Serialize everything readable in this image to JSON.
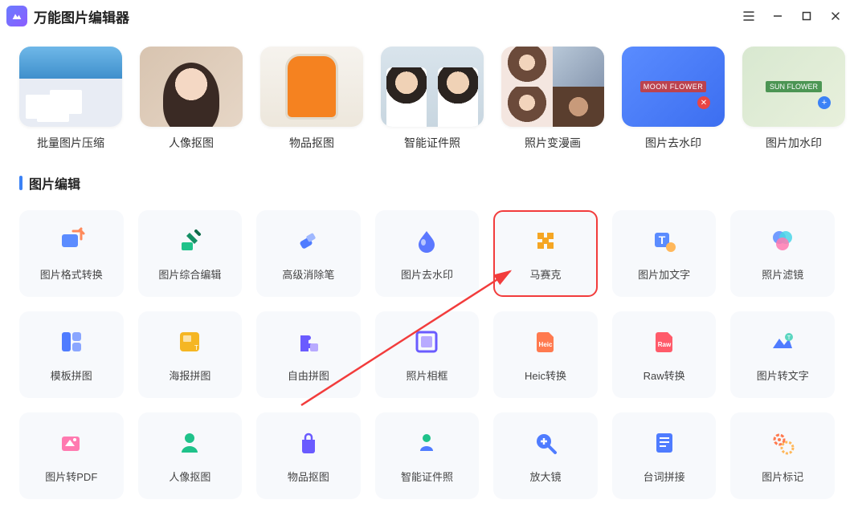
{
  "app": {
    "title": "万能图片编辑器"
  },
  "features": [
    {
      "label": "批量图片压缩"
    },
    {
      "label": "人像抠图"
    },
    {
      "label": "物品抠图"
    },
    {
      "label": "智能证件照"
    },
    {
      "label": "照片变漫画"
    },
    {
      "label": "图片去水印",
      "wm": "MOON FLOWER"
    },
    {
      "label": "图片加水印",
      "wm": "SUN FLOWER"
    }
  ],
  "section": {
    "title": "图片编辑"
  },
  "tools": [
    {
      "label": "图片格式转换",
      "icon": "convert",
      "highlight": false
    },
    {
      "label": "图片综合编辑",
      "icon": "edit",
      "highlight": false
    },
    {
      "label": "高级消除笔",
      "icon": "eraser",
      "highlight": false
    },
    {
      "label": "图片去水印",
      "icon": "droplet",
      "highlight": false
    },
    {
      "label": "马赛克",
      "icon": "mosaic",
      "highlight": true
    },
    {
      "label": "图片加文字",
      "icon": "text",
      "highlight": false
    },
    {
      "label": "照片滤镜",
      "icon": "filter",
      "highlight": false
    },
    {
      "label": "模板拼图",
      "icon": "template",
      "highlight": false
    },
    {
      "label": "海报拼图",
      "icon": "poster",
      "highlight": false
    },
    {
      "label": "自由拼图",
      "icon": "puzzle",
      "highlight": false
    },
    {
      "label": "照片相框",
      "icon": "frame",
      "highlight": false
    },
    {
      "label": "Heic转换",
      "icon": "heic",
      "highlight": false
    },
    {
      "label": "Raw转换",
      "icon": "raw",
      "highlight": false
    },
    {
      "label": "图片转文字",
      "icon": "ocr",
      "highlight": false
    },
    {
      "label": "图片转PDF",
      "icon": "pdf",
      "highlight": false
    },
    {
      "label": "人像抠图",
      "icon": "person",
      "highlight": false
    },
    {
      "label": "物品抠图",
      "icon": "bag",
      "highlight": false
    },
    {
      "label": "智能证件照",
      "icon": "idphoto",
      "highlight": false
    },
    {
      "label": "放大镜",
      "icon": "zoom",
      "highlight": false
    },
    {
      "label": "台词拼接",
      "icon": "script",
      "highlight": false
    },
    {
      "label": "图片标记",
      "icon": "mark",
      "highlight": false
    }
  ]
}
